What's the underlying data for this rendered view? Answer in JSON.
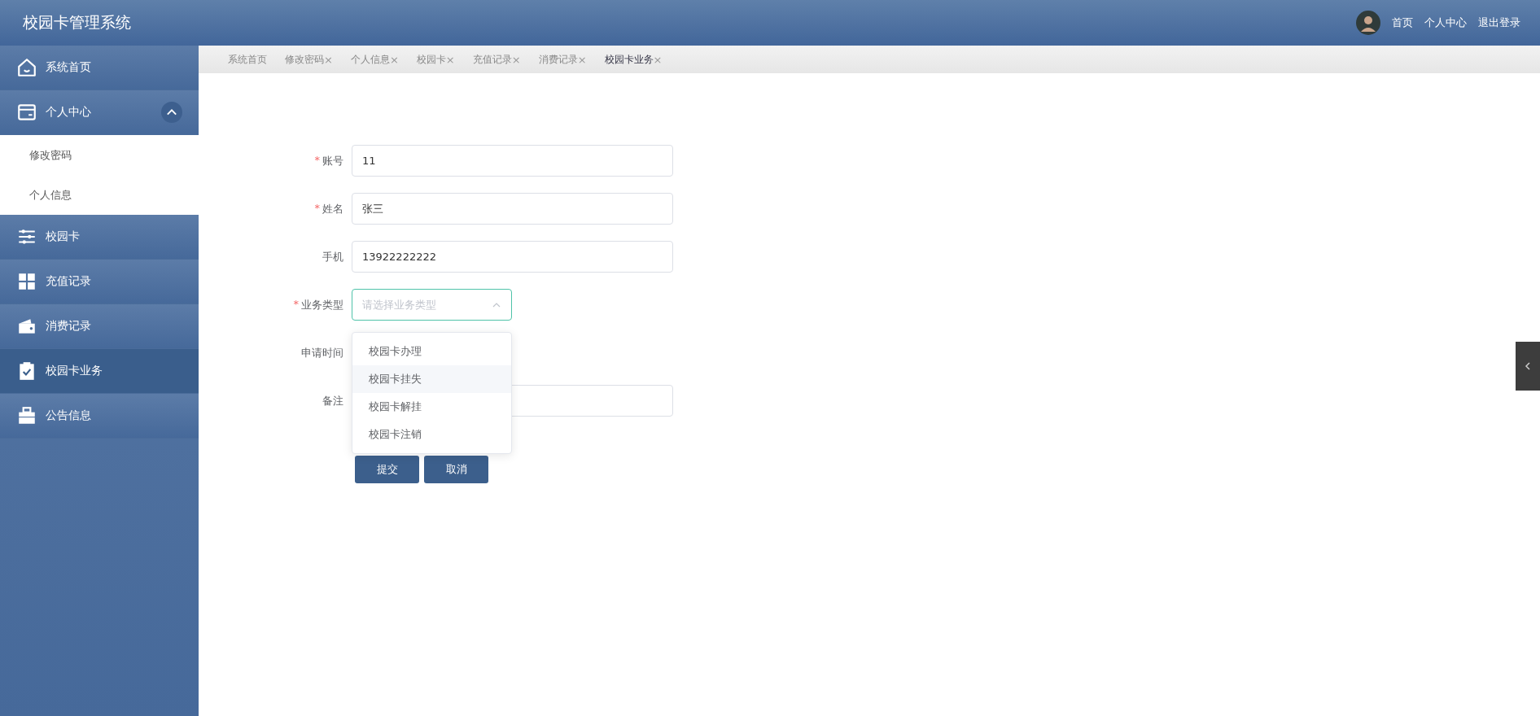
{
  "header": {
    "title": "校园卡管理系统",
    "links": [
      "首页",
      "个人中心",
      "退出登录"
    ]
  },
  "sidebar": {
    "items": [
      {
        "label": "系统首页",
        "selected": false
      },
      {
        "label": "个人中心",
        "selected": false,
        "expanded": true,
        "children": [
          {
            "label": "修改密码",
            "selected": false
          },
          {
            "label": "个人信息",
            "selected": false
          }
        ]
      },
      {
        "label": "校园卡",
        "selected": false
      },
      {
        "label": "充值记录",
        "selected": false
      },
      {
        "label": "消费记录",
        "selected": false
      },
      {
        "label": "校园卡业务",
        "selected": true
      },
      {
        "label": "公告信息",
        "selected": false
      }
    ]
  },
  "tabs": [
    {
      "label": "系统首页",
      "selected": false
    },
    {
      "label": "修改密码",
      "selected": false,
      "close": "×"
    },
    {
      "label": "个人信息",
      "selected": false,
      "close": "×"
    },
    {
      "label": "校园卡",
      "selected": false,
      "close": "×"
    },
    {
      "label": "充值记录",
      "selected": false,
      "close": "×"
    },
    {
      "label": "消费记录",
      "selected": false,
      "close": "×"
    },
    {
      "label": "校园卡业务",
      "selected": true,
      "close": "×"
    }
  ],
  "form": {
    "fields": [
      {
        "kind": "input",
        "label": "账号",
        "required_mark": "*",
        "value": "11"
      },
      {
        "kind": "input",
        "label": "姓名",
        "required_mark": "*",
        "value": "张三"
      },
      {
        "kind": "input",
        "label": "手机",
        "value": "13922222222"
      },
      {
        "kind": "select",
        "label": "业务类型",
        "required_mark": "*",
        "placeholder": "请选择业务类型",
        "open": true,
        "options": [
          {
            "label": "校园卡办理",
            "hovered": false
          },
          {
            "label": "校园卡挂失",
            "hovered": true
          },
          {
            "label": "校园卡解挂",
            "hovered": false
          },
          {
            "label": "校园卡注销",
            "hovered": false
          }
        ]
      },
      {
        "kind": "covered",
        "label": "申请时间"
      },
      {
        "kind": "input",
        "label": "备注"
      }
    ],
    "buttons": [
      "提交",
      "取消"
    ]
  }
}
